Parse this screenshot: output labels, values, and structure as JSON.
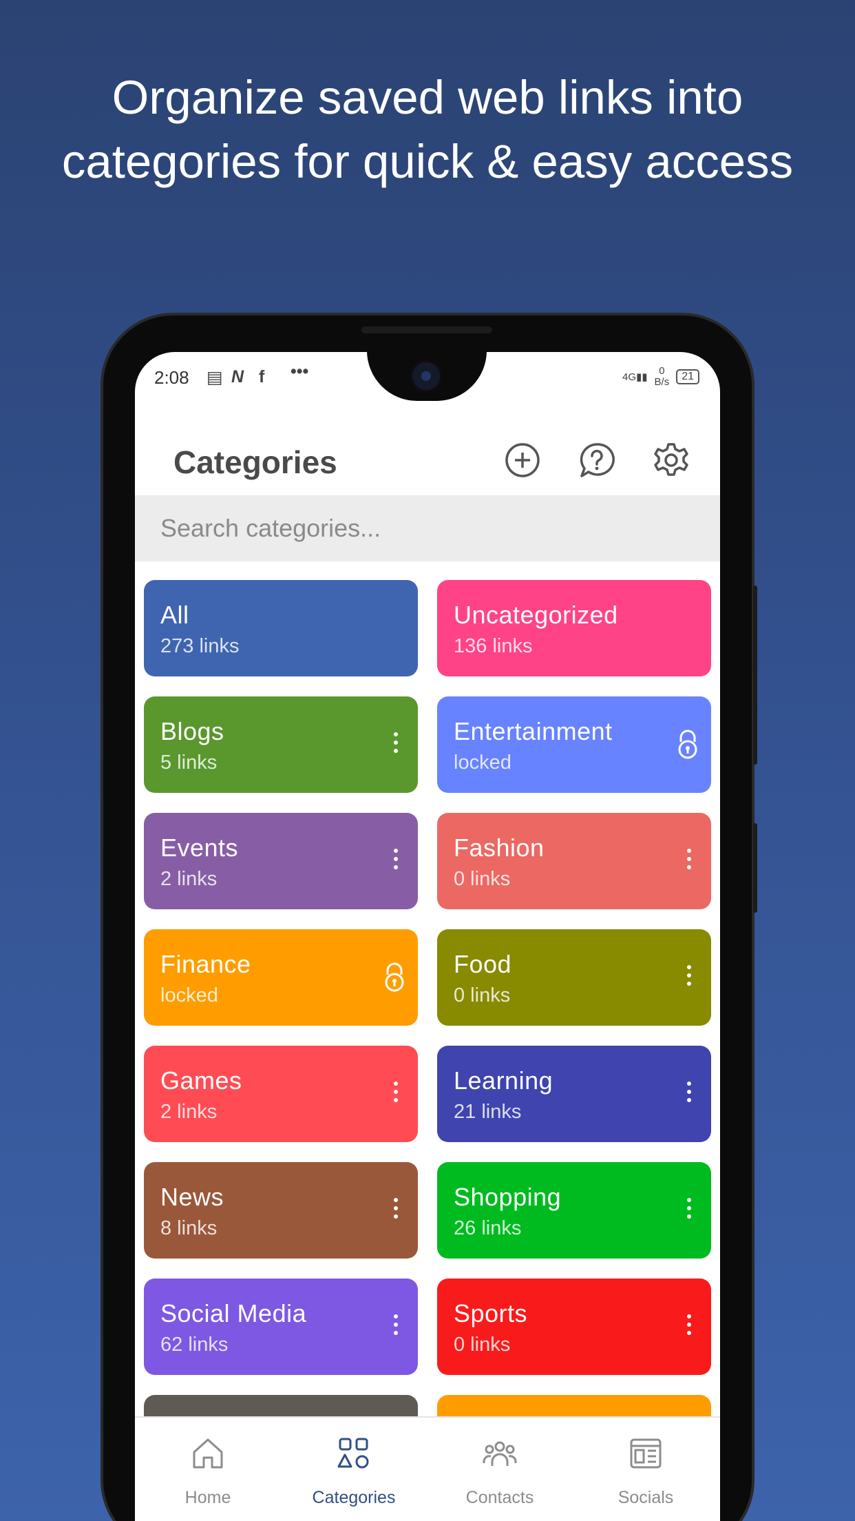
{
  "headline": {
    "line1": "Organize saved web links into",
    "line2": "categories for quick & easy access"
  },
  "status_bar": {
    "time": "2:08",
    "network": "4G",
    "speed_value": "0",
    "speed_unit": "B/s",
    "battery": "21"
  },
  "appbar": {
    "title": "Categories",
    "actions": [
      "add-circle-icon",
      "help-bubble-icon",
      "gear-icon"
    ]
  },
  "search": {
    "placeholder": "Search categories..."
  },
  "categories": [
    {
      "name": "All",
      "sub": "273 links",
      "color": "#3f65b0",
      "action": "none"
    },
    {
      "name": "Uncategorized",
      "sub": "136 links",
      "color": "#ff4386",
      "action": "none"
    },
    {
      "name": "Blogs",
      "sub": "5 links",
      "color": "#5a982e",
      "action": "more"
    },
    {
      "name": "Entertainment",
      "sub": " locked",
      "color": "#6783ff",
      "action": "lock"
    },
    {
      "name": "Events",
      "sub": "2 links",
      "color": "#875ea5",
      "action": "more"
    },
    {
      "name": "Fashion",
      "sub": "0 links",
      "color": "#ec6862",
      "action": "more"
    },
    {
      "name": "Finance",
      "sub": " locked",
      "color": "#ff9d00",
      "action": "lock"
    },
    {
      "name": "Food",
      "sub": "0 links",
      "color": "#888a00",
      "action": "more"
    },
    {
      "name": "Games",
      "sub": "2 links",
      "color": "#ff4c54",
      "action": "more"
    },
    {
      "name": "Learning",
      "sub": "21 links",
      "color": "#3f44ae",
      "action": "more"
    },
    {
      "name": "News",
      "sub": "8 links",
      "color": "#9a583a",
      "action": "more"
    },
    {
      "name": "Shopping",
      "sub": "26 links",
      "color": "#00bb20",
      "action": "more"
    },
    {
      "name": "Social Media",
      "sub": "62 links",
      "color": "#7e58e2",
      "action": "more"
    },
    {
      "name": "Sports",
      "sub": "0 links",
      "color": "#f91b1b",
      "action": "more"
    },
    {
      "name": "",
      "sub": "",
      "color": "#5f5a53",
      "action": "none"
    },
    {
      "name": "",
      "sub": "",
      "color": "#ff9d00",
      "action": "none"
    }
  ],
  "bottom_nav": [
    {
      "label": "Home",
      "icon": "home-icon",
      "active": false
    },
    {
      "label": "Categories",
      "icon": "categories-icon",
      "active": true
    },
    {
      "label": "Contacts",
      "icon": "contacts-icon",
      "active": false
    },
    {
      "label": "Socials",
      "icon": "socials-icon",
      "active": false
    }
  ],
  "colors": {
    "background_top": "#2b4373",
    "background_bottom": "#3d63ab",
    "nav_active": "#2f4f86",
    "nav_inactive": "#8c8c8c"
  }
}
